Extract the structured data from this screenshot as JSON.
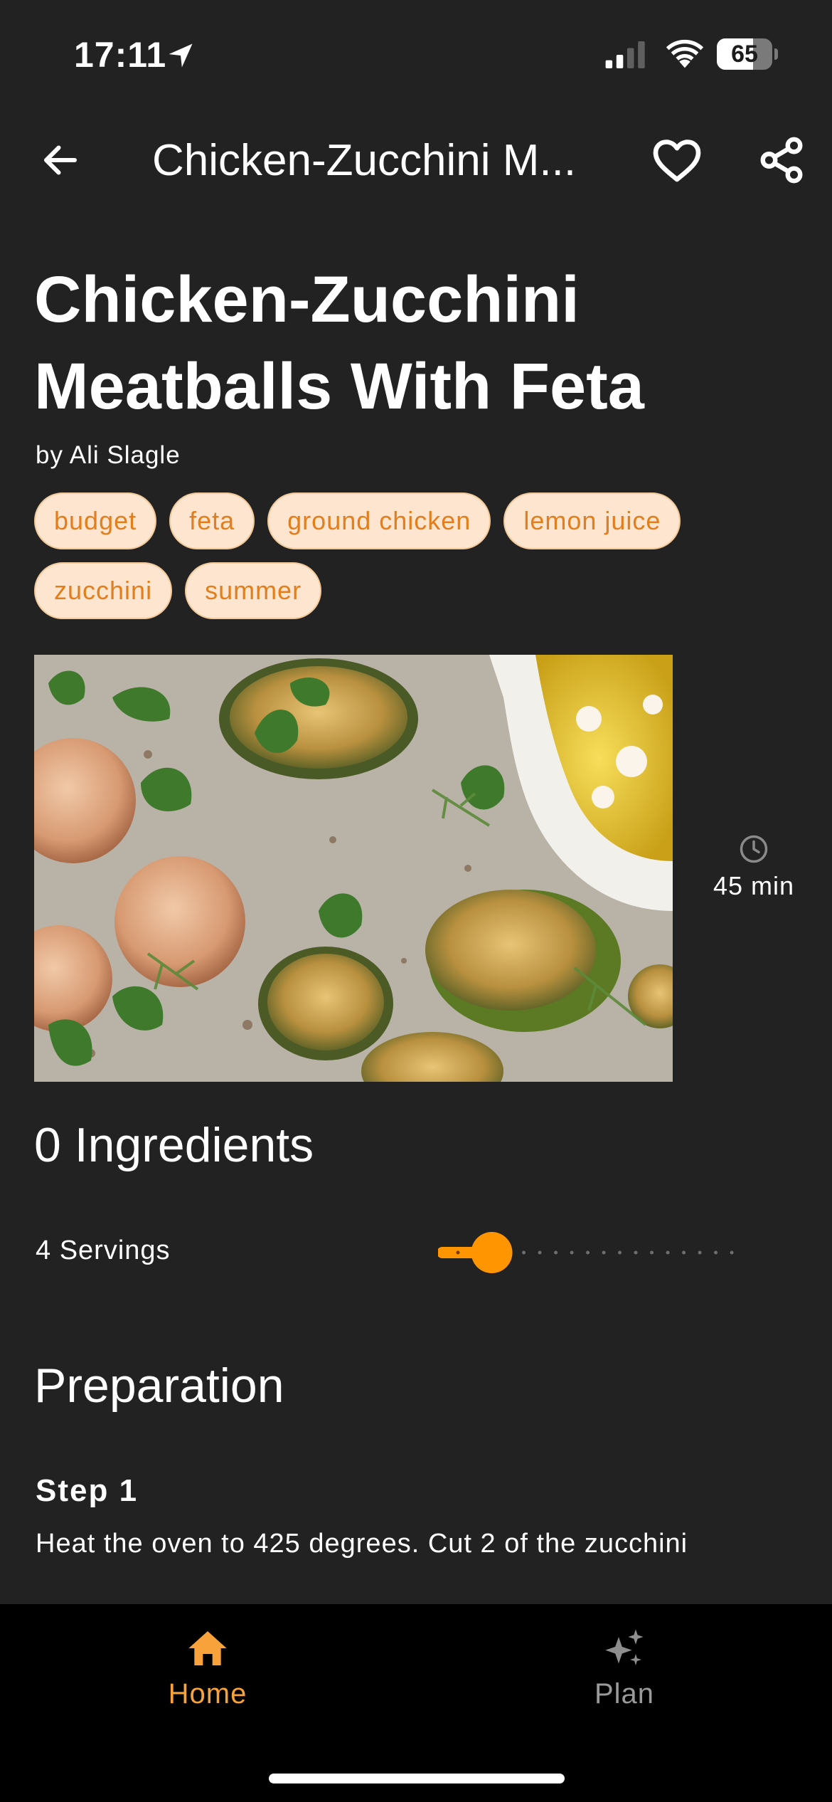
{
  "status_bar": {
    "time": "17:11",
    "battery_level": "65",
    "battery_fraction": 0.65,
    "icons": [
      "location-arrow-icon",
      "cellular-signal-icon",
      "wifi-icon",
      "battery-icon"
    ]
  },
  "app_bar": {
    "title": "Chicken-Zucchini M...",
    "icons": [
      "back-arrow-icon",
      "heart-icon",
      "share-icon"
    ]
  },
  "recipe": {
    "title": "Chicken-Zucchini Meatballs With Feta",
    "author": "by Ali Slagle",
    "tags": [
      "budget",
      "feta",
      "ground chicken",
      "lemon juice",
      "zucchini",
      "summer"
    ],
    "time": "45 min",
    "time_icon": "clock-icon",
    "ingredients_heading": "0 Ingredients",
    "servings_label": "4 Servings",
    "servings_slider": {
      "value": 4,
      "min": 2,
      "max": 30
    },
    "preparation_heading": "Preparation",
    "steps": [
      {
        "title": "Step 1",
        "text": "Heat the oven to 425 degrees. Cut 2 of the zucchini"
      }
    ]
  },
  "bottom_nav": {
    "items": [
      {
        "label": "Home",
        "icon": "home-icon",
        "active": true
      },
      {
        "label": "Plan",
        "icon": "sparkles-icon",
        "active": false
      }
    ]
  },
  "colors": {
    "background": "#222222",
    "accent": "#f7a23a",
    "slider": "#ff9500",
    "tag_fill": "#fde5cf",
    "tag_text": "#e27e1c",
    "nav_background": "#000000"
  }
}
